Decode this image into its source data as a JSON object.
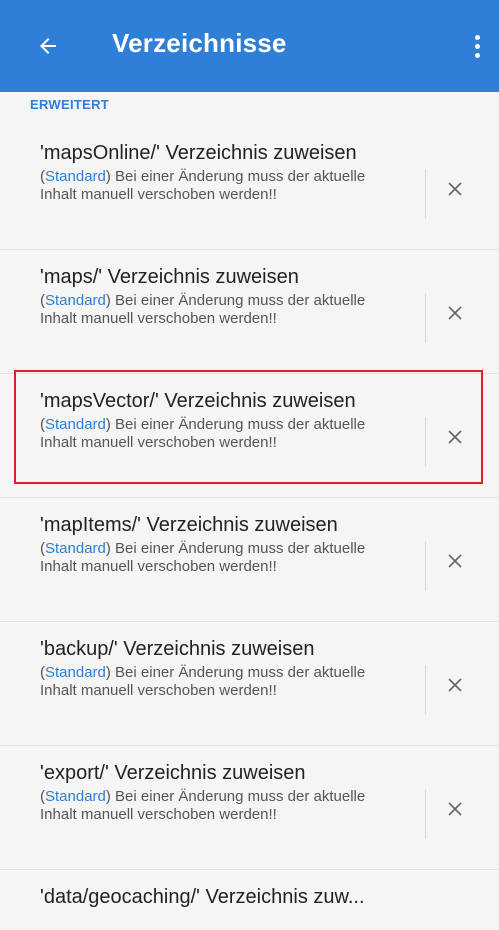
{
  "appbar": {
    "title": "Verzeichnisse",
    "back_icon": "arrow-left-icon",
    "menu_icon": "more-vert-icon",
    "color": "#2f7fd6"
  },
  "section": {
    "header": "ERWEITERT"
  },
  "items": [
    {
      "title": "'mapsOnline/' Verzeichnis zuweisen",
      "std": "Standard",
      "desc_prefix": "(",
      "desc_rest": ") Bei einer Änderung muss der aktuelle Inhalt manuell verschoben werden!!"
    },
    {
      "title": "'maps/' Verzeichnis zuweisen",
      "std": "Standard",
      "desc_prefix": "(",
      "desc_rest": ") Bei einer Änderung muss der aktuelle Inhalt manuell verschoben werden!!"
    },
    {
      "title": "'mapsVector/' Verzeichnis zuweisen",
      "std": "Standard",
      "desc_prefix": "(",
      "desc_rest": ") Bei einer Änderung muss der aktuelle Inhalt manuell verschoben werden!!"
    },
    {
      "title": "'mapItems/' Verzeichnis zuweisen",
      "std": "Standard",
      "desc_prefix": "(",
      "desc_rest": ") Bei einer Änderung muss der aktuelle Inhalt manuell verschoben werden!!"
    },
    {
      "title": "'backup/' Verzeichnis zuweisen",
      "std": "Standard",
      "desc_prefix": "(",
      "desc_rest": ") Bei einer Änderung muss der aktuelle Inhalt manuell verschoben werden!!"
    },
    {
      "title": "'export/' Verzeichnis zuweisen",
      "std": "Standard",
      "desc_prefix": "(",
      "desc_rest": ") Bei einer Änderung muss der aktuelle Inhalt manuell verschoben werden!!"
    },
    {
      "title": "'data/geocaching/' Verzeichnis zuw..."
    }
  ],
  "clear_icon": "close-icon",
  "highlight_color": "#e02020"
}
